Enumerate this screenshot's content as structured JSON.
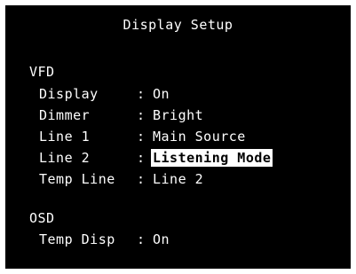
{
  "title": "Display Setup",
  "sections": [
    {
      "label": "VFD",
      "rows": [
        {
          "label": "Display",
          "sep": ":",
          "value": "On"
        },
        {
          "label": "Dimmer",
          "sep": ":",
          "value": "Bright"
        },
        {
          "label": "Line 1",
          "sep": ":",
          "value": "Main Source"
        },
        {
          "label": "Line 2",
          "sep": ":",
          "value": "Listening Mode",
          "selected": true
        },
        {
          "label": "Temp Line",
          "sep": ":",
          "value": "Line 2"
        }
      ]
    },
    {
      "label": "OSD",
      "rows": [
        {
          "label": "Temp Disp",
          "sep": ":",
          "value": "On"
        }
      ]
    }
  ],
  "colors": {
    "background": "#000000",
    "text": "#ffffff",
    "highlight": "#ffffff",
    "highlight_text": "#000000"
  }
}
